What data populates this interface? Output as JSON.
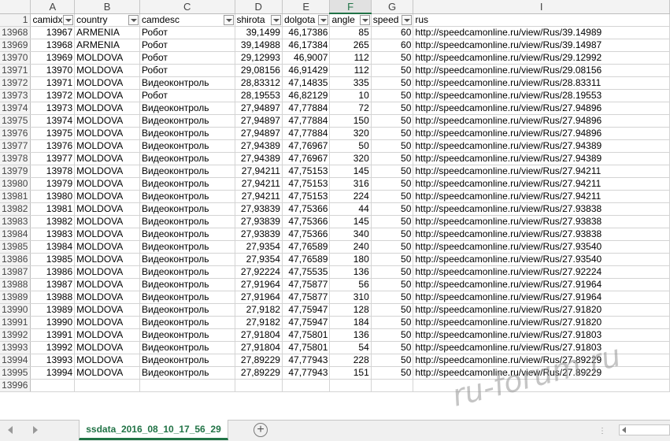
{
  "column_letters": [
    "",
    "A",
    "B",
    "C",
    "D",
    "E",
    "F",
    "G",
    "I"
  ],
  "selected_column": "F",
  "header_row_number": "1",
  "headers": [
    "camidx",
    "country",
    "camdesc",
    "shirota",
    "dolgota",
    "angle",
    "speed",
    "rus"
  ],
  "rows": [
    [
      "13968",
      "13967",
      "ARMENIA",
      "Робот",
      "39,1499",
      "46,17386",
      "85",
      "60",
      "http://speedcamonline.ru/view/Rus/39.14989"
    ],
    [
      "13969",
      "13968",
      "ARMENIA",
      "Робот",
      "39,14988",
      "46,17384",
      "265",
      "60",
      "http://speedcamonline.ru/view/Rus/39.14987"
    ],
    [
      "13970",
      "13969",
      "MOLDOVA",
      "Робот",
      "29,12993",
      "46,9007",
      "112",
      "50",
      "http://speedcamonline.ru/view/Rus/29.12992"
    ],
    [
      "13971",
      "13970",
      "MOLDOVA",
      "Робот",
      "29,08156",
      "46,91429",
      "112",
      "50",
      "http://speedcamonline.ru/view/Rus/29.08156"
    ],
    [
      "13972",
      "13971",
      "MOLDOVA",
      "Видеоконтроль",
      "28,83312",
      "47,14835",
      "335",
      "50",
      "http://speedcamonline.ru/view/Rus/28.83311"
    ],
    [
      "13973",
      "13972",
      "MOLDOVA",
      "Робот",
      "28,19553",
      "46,82129",
      "10",
      "50",
      "http://speedcamonline.ru/view/Rus/28.19553"
    ],
    [
      "13974",
      "13973",
      "MOLDOVA",
      "Видеоконтроль",
      "27,94897",
      "47,77884",
      "72",
      "50",
      "http://speedcamonline.ru/view/Rus/27.94896"
    ],
    [
      "13975",
      "13974",
      "MOLDOVA",
      "Видеоконтроль",
      "27,94897",
      "47,77884",
      "150",
      "50",
      "http://speedcamonline.ru/view/Rus/27.94896"
    ],
    [
      "13976",
      "13975",
      "MOLDOVA",
      "Видеоконтроль",
      "27,94897",
      "47,77884",
      "320",
      "50",
      "http://speedcamonline.ru/view/Rus/27.94896"
    ],
    [
      "13977",
      "13976",
      "MOLDOVA",
      "Видеоконтроль",
      "27,94389",
      "47,76967",
      "50",
      "50",
      "http://speedcamonline.ru/view/Rus/27.94389"
    ],
    [
      "13978",
      "13977",
      "MOLDOVA",
      "Видеоконтроль",
      "27,94389",
      "47,76967",
      "320",
      "50",
      "http://speedcamonline.ru/view/Rus/27.94389"
    ],
    [
      "13979",
      "13978",
      "MOLDOVA",
      "Видеоконтроль",
      "27,94211",
      "47,75153",
      "145",
      "50",
      "http://speedcamonline.ru/view/Rus/27.94211"
    ],
    [
      "13980",
      "13979",
      "MOLDOVA",
      "Видеоконтроль",
      "27,94211",
      "47,75153",
      "316",
      "50",
      "http://speedcamonline.ru/view/Rus/27.94211"
    ],
    [
      "13981",
      "13980",
      "MOLDOVA",
      "Видеоконтроль",
      "27,94211",
      "47,75153",
      "224",
      "50",
      "http://speedcamonline.ru/view/Rus/27.94211"
    ],
    [
      "13982",
      "13981",
      "MOLDOVA",
      "Видеоконтроль",
      "27,93839",
      "47,75366",
      "44",
      "50",
      "http://speedcamonline.ru/view/Rus/27.93838"
    ],
    [
      "13983",
      "13982",
      "MOLDOVA",
      "Видеоконтроль",
      "27,93839",
      "47,75366",
      "145",
      "50",
      "http://speedcamonline.ru/view/Rus/27.93838"
    ],
    [
      "13984",
      "13983",
      "MOLDOVA",
      "Видеоконтроль",
      "27,93839",
      "47,75366",
      "340",
      "50",
      "http://speedcamonline.ru/view/Rus/27.93838"
    ],
    [
      "13985",
      "13984",
      "MOLDOVA",
      "Видеоконтроль",
      "27,9354",
      "47,76589",
      "240",
      "50",
      "http://speedcamonline.ru/view/Rus/27.93540"
    ],
    [
      "13986",
      "13985",
      "MOLDOVA",
      "Видеоконтроль",
      "27,9354",
      "47,76589",
      "180",
      "50",
      "http://speedcamonline.ru/view/Rus/27.93540"
    ],
    [
      "13987",
      "13986",
      "MOLDOVA",
      "Видеоконтроль",
      "27,92224",
      "47,75535",
      "136",
      "50",
      "http://speedcamonline.ru/view/Rus/27.92224"
    ],
    [
      "13988",
      "13987",
      "MOLDOVA",
      "Видеоконтроль",
      "27,91964",
      "47,75877",
      "56",
      "50",
      "http://speedcamonline.ru/view/Rus/27.91964"
    ],
    [
      "13989",
      "13988",
      "MOLDOVA",
      "Видеоконтроль",
      "27,91964",
      "47,75877",
      "310",
      "50",
      "http://speedcamonline.ru/view/Rus/27.91964"
    ],
    [
      "13990",
      "13989",
      "MOLDOVA",
      "Видеоконтроль",
      "27,9182",
      "47,75947",
      "128",
      "50",
      "http://speedcamonline.ru/view/Rus/27.91820"
    ],
    [
      "13991",
      "13990",
      "MOLDOVA",
      "Видеоконтроль",
      "27,9182",
      "47,75947",
      "184",
      "50",
      "http://speedcamonline.ru/view/Rus/27.91820"
    ],
    [
      "13992",
      "13991",
      "MOLDOVA",
      "Видеоконтроль",
      "27,91804",
      "47,75801",
      "136",
      "50",
      "http://speedcamonline.ru/view/Rus/27.91803"
    ],
    [
      "13993",
      "13992",
      "MOLDOVA",
      "Видеоконтроль",
      "27,91804",
      "47,75801",
      "54",
      "50",
      "http://speedcamonline.ru/view/Rus/27.91803"
    ],
    [
      "13994",
      "13993",
      "MOLDOVA",
      "Видеоконтроль",
      "27,89229",
      "47,77943",
      "228",
      "50",
      "http://speedcamonline.ru/view/Rus/27.89229"
    ],
    [
      "13995",
      "13994",
      "MOLDOVA",
      "Видеоконтроль",
      "27,89229",
      "47,77943",
      "151",
      "50",
      "http://speedcamonline.ru/view/Rus/27.89229"
    ],
    [
      "13996",
      "",
      "",
      "",
      "",
      "",
      "",
      "",
      ""
    ]
  ],
  "numeric_columns": [
    1,
    4,
    5,
    6,
    7
  ],
  "sheet_tab": "ssdata_2016_08_10_17_56_29",
  "add_sheet_symbol": "+",
  "watermark": "ru-forum.ru",
  "icons": {
    "prev_sheet": "triangle-left-icon",
    "next_sheet": "triangle-right-icon",
    "filter": "filter-dropdown-icon",
    "add": "plus-circle-icon"
  },
  "colors": {
    "excel_green": "#217346",
    "header_bg": "#f3f3f3",
    "gridline": "#d4d4d4"
  }
}
